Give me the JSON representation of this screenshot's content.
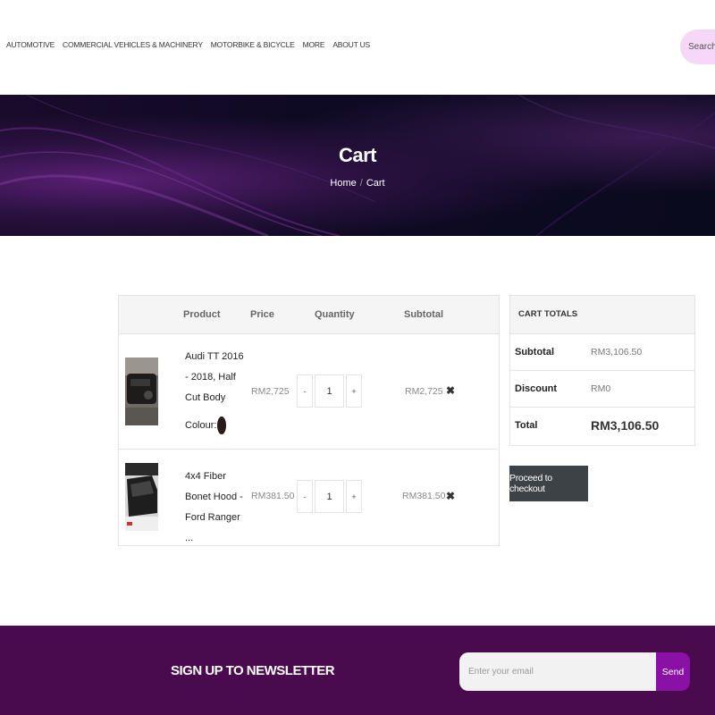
{
  "nav": {
    "items": [
      "AUTOMOTIVE",
      "COMMERCIAL VEHICLES & MACHINERY",
      "MOTORBIKE & BICYCLE",
      "MORE",
      "ABOUT US"
    ],
    "search_text": "Search F"
  },
  "hero": {
    "title": "Cart",
    "breadcrumb": {
      "home": "Home",
      "separator": "/",
      "current": "Cart"
    }
  },
  "cart": {
    "headers": {
      "product": "Product",
      "price": "Price",
      "quantity": "Quantity",
      "subtotal": "Subtotal"
    },
    "items": [
      {
        "name": "Audi TT 2016 - 2018, Half Cut Body",
        "colour_label": "Colour:",
        "price": "RM2,725",
        "qty_minus": "-",
        "quantity": "1",
        "qty_plus": "+",
        "subtotal": "RM2,725",
        "remove": "✖"
      },
      {
        "name": "4x4 Fiber Bonet Hood - Ford Ranger ...",
        "price": "RM381.50",
        "qty_minus": "-",
        "quantity": "1",
        "qty_plus": "+",
        "subtotal": "RM381.50",
        "remove": "✖"
      }
    ]
  },
  "totals": {
    "heading": "CART TOTALS",
    "subtotal_label": "Subtotal",
    "subtotal_value": "RM3,106.50",
    "discount_label": "Discount",
    "discount_value": "RM0",
    "total_label": "Total",
    "total_value": "RM3,106.50",
    "checkout_label": "Proceed to checkout"
  },
  "newsletter": {
    "title": "SIGN UP TO NEWSLETTER",
    "placeholder": "Enter your email",
    "send_label": "Send"
  },
  "colors": {
    "newsletter_bg": "#4a0b4e",
    "send_button": "#8a10a6",
    "checkout_button": "#3d4246",
    "search_pill": "#f7d7f7"
  }
}
